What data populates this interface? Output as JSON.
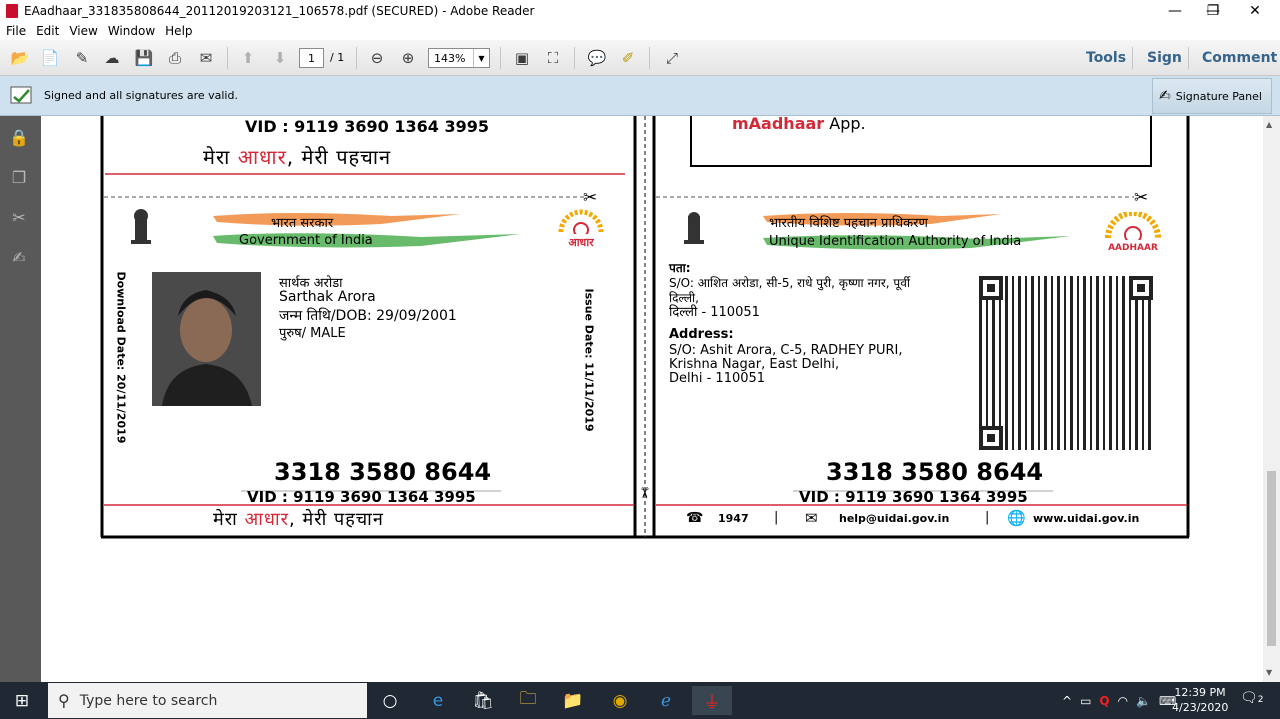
{
  "window": {
    "title": "EAadhaar_331835808644_20112019203121_106578.pdf (SECURED) - Adobe Reader",
    "controls": {
      "minimize": "—",
      "restore": "❐",
      "close": "✕"
    }
  },
  "menu": [
    "File",
    "Edit",
    "View",
    "Window",
    "Help"
  ],
  "toolbar": {
    "page_current": "1",
    "page_total": "/ 1",
    "zoom": "143%",
    "tools_label": "Tools",
    "sign_label": "Sign",
    "comment_label": "Comment"
  },
  "signature_bar": {
    "message": "Signed and all signatures are valid.",
    "panel_label": "Signature Panel"
  },
  "document": {
    "vid": "VID : 9119 3690 1364 3995",
    "tagline_a": "मेरा ",
    "tagline_b": "आधार",
    "tagline_c": ", मेरी पहचान",
    "front": {
      "gov_hindi": "भारत सरकार",
      "gov_english": "Government of India",
      "logo_text": "आधार",
      "name_hindi": "सार्थक अरोडा",
      "name_english": "Sarthak Arora",
      "dob": "जन्म तिथि/DOB: 29/09/2001",
      "gender": "पुरुष/ MALE",
      "download_date": "Download Date: 20/11/2019",
      "issue_date": "Issue Date: 11/11/2019",
      "aadhaar_number": "3318 3580 8644"
    },
    "back": {
      "app_text": "mAadhaar",
      "app_suffix": " App.",
      "authority_hindi": "भारतीय विशिष्ट पहचान प्राधिकरण",
      "authority_english": "Unique Identification Authority of India",
      "logo_text": "AADHAAR",
      "address_label_hindi": "पता:",
      "address_hindi_1": "S/O: आशित अरोडा, सी-5, राधे पुरी, कृष्णा नगर, पूर्वी",
      "address_hindi_2": "दिल्ली,",
      "address_hindi_3": "दिल्ली - 110051",
      "address_label": "Address:",
      "address_1": "S/O: Ashit Arora, C-5, RADHEY PURI,",
      "address_2": "Krishna Nagar, East Delhi,",
      "address_3": "Delhi - 110051",
      "aadhaar_number": "3318 3580 8644",
      "phone": "1947",
      "email": "help@uidai.gov.in",
      "website": "www.uidai.gov.in",
      "divider": "|"
    }
  },
  "taskbar": {
    "search_placeholder": "Type here to search",
    "time": "12:39 PM",
    "date": "4/23/2020",
    "notification_count": "2"
  },
  "colors": {
    "red": "#d32a3a",
    "saffron": "#f08a3c",
    "green": "#4caf50",
    "taskbar": "#1f2833",
    "signature_bar": "#cfe1ee"
  }
}
